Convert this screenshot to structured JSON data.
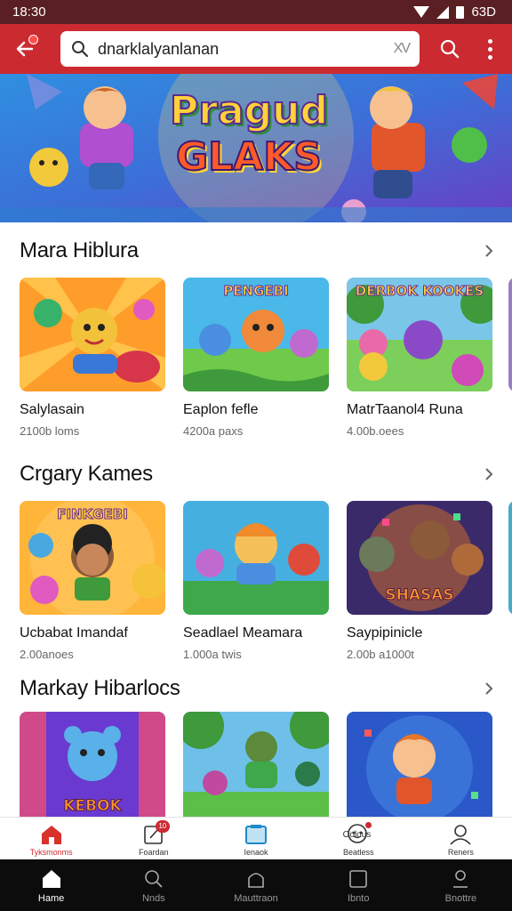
{
  "status_bar": {
    "time": "18:30",
    "battery": "63D"
  },
  "search": {
    "value": "dnarklalyanlanan",
    "clear_label": "XV"
  },
  "banner": {
    "title_line1": "Pragud",
    "title_line2": "GLAKS"
  },
  "sections": [
    {
      "title": "Mara Hiblura",
      "cards": [
        {
          "title": "Salylasain",
          "subtitle": "2100b loms",
          "caption": ""
        },
        {
          "title": "Eaplon fefle",
          "subtitle": "4200a paxs",
          "caption": "PENGEBI"
        },
        {
          "title": "MatrTaanol4 Runa",
          "subtitle": "4.00b.oees",
          "caption": "DERBOK KOOKES"
        }
      ]
    },
    {
      "title": "Crgary Kames",
      "cards": [
        {
          "title": "Ucbabat Imandaf",
          "subtitle": "2.00anoes",
          "caption": "FINKGEBI"
        },
        {
          "title": "Seadlael Meamara",
          "subtitle": "1.000a twis",
          "caption": ""
        },
        {
          "title": "Saypipinicle",
          "subtitle": "2.00b a1000t",
          "caption": "SHASAS"
        }
      ]
    },
    {
      "title": "Markay Hibarlocs",
      "cards": [
        {
          "title": "",
          "subtitle": "",
          "caption": "KEBOK"
        },
        {
          "title": "",
          "subtitle": "",
          "caption": ""
        },
        {
          "title": "",
          "subtitle": "",
          "caption": ""
        }
      ]
    }
  ],
  "bottom_nav": [
    {
      "label": "Tyksmonms",
      "icon": "home-icon",
      "active": true
    },
    {
      "label": "Foardan",
      "icon": "edit-icon",
      "badge": "10"
    },
    {
      "label": "Ienaok",
      "icon": "tablet-icon"
    },
    {
      "label": "Beatless",
      "icon": "chat-icon",
      "extra": "Oolous"
    },
    {
      "label": "Reners",
      "icon": "profile-icon"
    }
  ],
  "system_nav": [
    {
      "label": "Hame",
      "icon": "home-icon",
      "active": true
    },
    {
      "label": "Nnds",
      "icon": "search-icon"
    },
    {
      "label": "Mauttraon",
      "icon": "shape-icon"
    },
    {
      "label": "Ibnto",
      "icon": "square-icon"
    },
    {
      "label": "Bnottre",
      "icon": "person-icon"
    }
  ],
  "colors": {
    "accent": "#cc2a31",
    "status_bar": "#5a1f22",
    "system_nav": "#0c0c0c"
  }
}
